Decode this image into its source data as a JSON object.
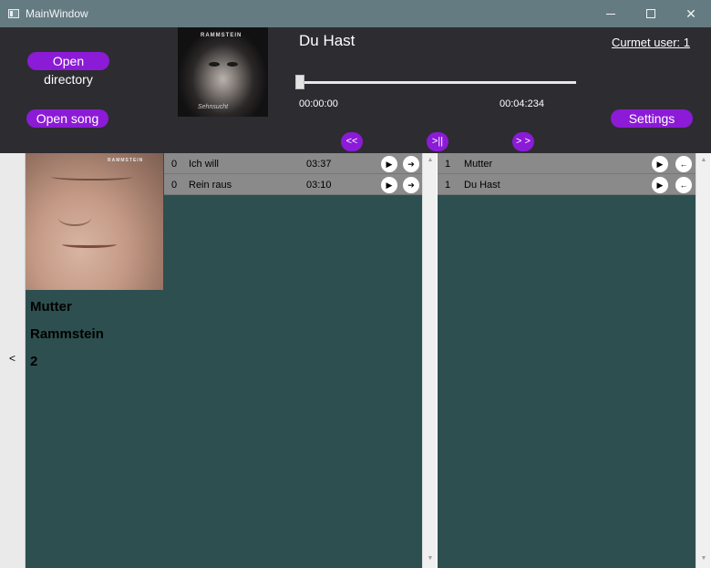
{
  "window": {
    "title": "MainWindow"
  },
  "header": {
    "open_directory": "Open directory",
    "open_song": "Open song",
    "settings": "Settings",
    "song_title": "Du Hast",
    "time_current": "00:00:00",
    "time_total": "00:04:234",
    "progress_fraction": 0,
    "user_label": "Curmet user: 1",
    "prev_label": "<<",
    "play_label": ">||",
    "next_label": "> >",
    "small_cover_band_text": "RAMMSTEIN",
    "small_cover_signature": "Sehnsucht"
  },
  "left_panel": {
    "collapse_label": "<",
    "album_cover_band_text": "RAMMSTEIN",
    "album_name": "Mutter",
    "artist_name": "Rammstein",
    "count": "2"
  },
  "left_list": [
    {
      "num": "0",
      "name": "Ich will",
      "duration": "03:37"
    },
    {
      "num": "0",
      "name": "Rein raus",
      "duration": "03:10"
    }
  ],
  "right_list": [
    {
      "num": "1",
      "name": "Mutter"
    },
    {
      "num": "1",
      "name": "Du Hast"
    }
  ],
  "icons": {
    "play": "▶",
    "add": "➔",
    "remove": "←"
  },
  "colors": {
    "accent": "#8b1bd6",
    "header_bg": "#2d2c31",
    "pane_bg": "#2e4f4f",
    "row_bg": "#8a8a8a",
    "titlebar_bg": "#657b82"
  }
}
